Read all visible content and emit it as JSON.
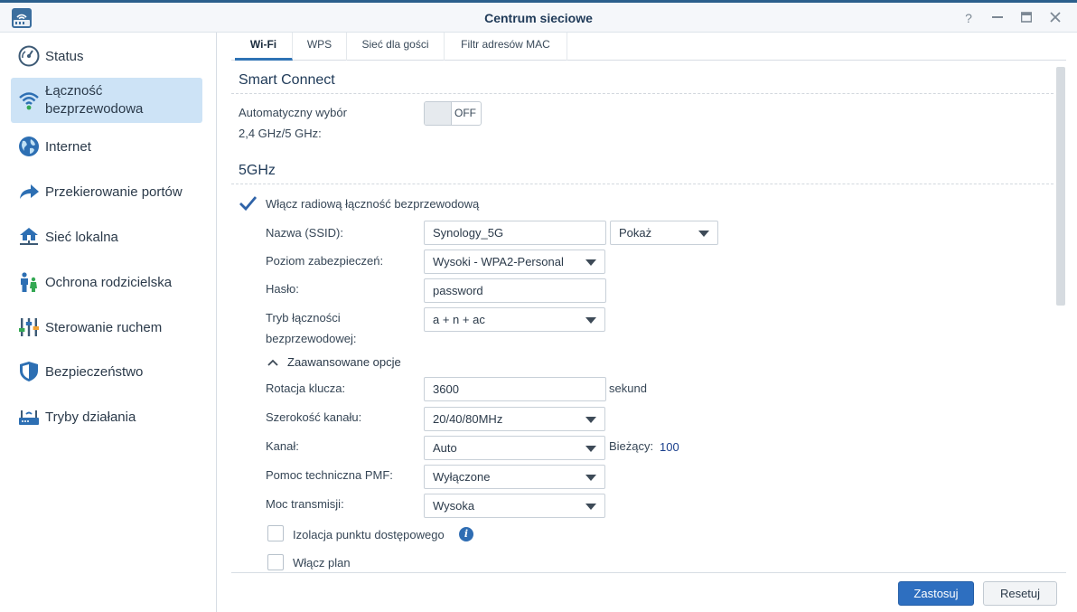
{
  "window": {
    "title": "Centrum sieciowe",
    "controls": [
      "help-icon",
      "minimize-icon",
      "maximize-icon",
      "close-icon"
    ]
  },
  "sidebar": {
    "items": [
      {
        "label": "Status",
        "icon": "gauge-icon"
      },
      {
        "label": "Łączność bezprzewodowa",
        "line1": "Łączność",
        "line2": "bezprzewodowa",
        "icon": "wifi-icon",
        "active": true
      },
      {
        "label": "Internet",
        "icon": "globe-icon"
      },
      {
        "label": "Przekierowanie portów",
        "icon": "forward-arrow-icon"
      },
      {
        "label": "Sieć lokalna",
        "icon": "home-network-icon"
      },
      {
        "label": "Ochrona rodzicielska",
        "icon": "family-icon"
      },
      {
        "label": "Sterowanie ruchem",
        "icon": "sliders-icon"
      },
      {
        "label": "Bezpieczeństwo",
        "icon": "shield-icon"
      },
      {
        "label": "Tryby działania",
        "icon": "router-icon"
      }
    ]
  },
  "tabs": [
    {
      "label": "Wi-Fi",
      "active": true
    },
    {
      "label": "WPS"
    },
    {
      "label": "Sieć dla gości"
    },
    {
      "label": "Filtr adresów MAC"
    }
  ],
  "smart_connect": {
    "title": "Smart Connect",
    "auto_label_line1": "Automatyczny wybór",
    "auto_label_line2": "2,4 GHz/5 GHz:",
    "toggle_state": "OFF"
  },
  "band_5ghz": {
    "title": "5GHz",
    "enable_label": "Włącz radiową łączność bezprzewodową",
    "enable_checked": true,
    "ssid_label": "Nazwa (SSID):",
    "ssid_value": "Synology_5G",
    "ssid_visibility": "Pokaż",
    "security_label": "Poziom zabezpieczeń:",
    "security_value": "Wysoki - WPA2-Personal",
    "password_label": "Hasło:",
    "password_value": "password",
    "mode_label_line1": "Tryb łączności",
    "mode_label_line2": "bezprzewodowej:",
    "mode_value": "a + n + ac",
    "advanced_toggle": "Zaawansowane opcje",
    "key_rotation_label": "Rotacja klucza:",
    "key_rotation_value": "3600",
    "key_rotation_unit": "sekund",
    "channel_width_label": "Szerokość kanału:",
    "channel_width_value": "20/40/80MHz",
    "channel_label": "Kanał:",
    "channel_value": "Auto",
    "current_label": "Bieżący:",
    "current_value": "100",
    "pmf_label": "Pomoc techniczna PMF:",
    "pmf_value": "Wyłączone",
    "tx_power_label": "Moc transmisji:",
    "tx_power_value": "Wysoka",
    "ap_isolation_label": "Izolacja punktu dostępowego",
    "ap_isolation_checked": false,
    "schedule_label": "Włącz plan",
    "schedule_checked": false
  },
  "footer": {
    "apply_label": "Zastosuj",
    "reset_label": "Resetuj"
  },
  "colors": {
    "accent": "#2e6fc0",
    "sidebar_active": "#cde3f6",
    "title_text": "#1f3a58"
  }
}
